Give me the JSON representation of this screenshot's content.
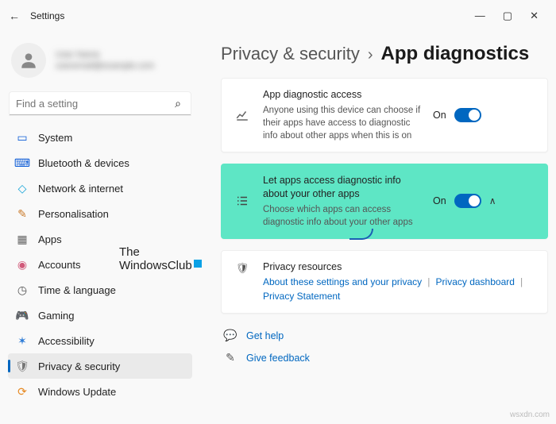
{
  "titlebar": {
    "back_glyph": "←",
    "title": "Settings",
    "min": "—",
    "max": "▢",
    "close": "✕"
  },
  "profile": {
    "name": "User Name",
    "email": "useremail@example.com"
  },
  "search": {
    "placeholder": "Find a setting",
    "icon": "⌕"
  },
  "nav": {
    "system": "System",
    "bluetooth": "Bluetooth & devices",
    "network": "Network & internet",
    "personalisation": "Personalisation",
    "apps": "Apps",
    "accounts": "Accounts",
    "time": "Time & language",
    "gaming": "Gaming",
    "accessibility": "Accessibility",
    "privacy": "Privacy & security",
    "update": "Windows Update"
  },
  "breadcrumb": {
    "parent": "Privacy & security",
    "sep": "›",
    "current": "App diagnostics"
  },
  "card1": {
    "title": "App diagnostic access",
    "desc": "Anyone using this device can choose if their apps have access to diagnostic info about other apps when this is on",
    "state": "On"
  },
  "card2": {
    "title": "Let apps access diagnostic info about your other apps",
    "desc": "Choose which apps can access diagnostic info about your other apps",
    "state": "On",
    "chev": "∧"
  },
  "card3": {
    "title": "Privacy resources",
    "link1": "About these settings and your privacy",
    "link2": "Privacy dashboard",
    "link3": "Privacy Statement",
    "sep": "|"
  },
  "help": {
    "get_help": "Get help",
    "feedback": "Give feedback"
  },
  "watermark": {
    "l1": "The",
    "l2": "WindowsClub"
  },
  "footer": "wsxdn.com"
}
